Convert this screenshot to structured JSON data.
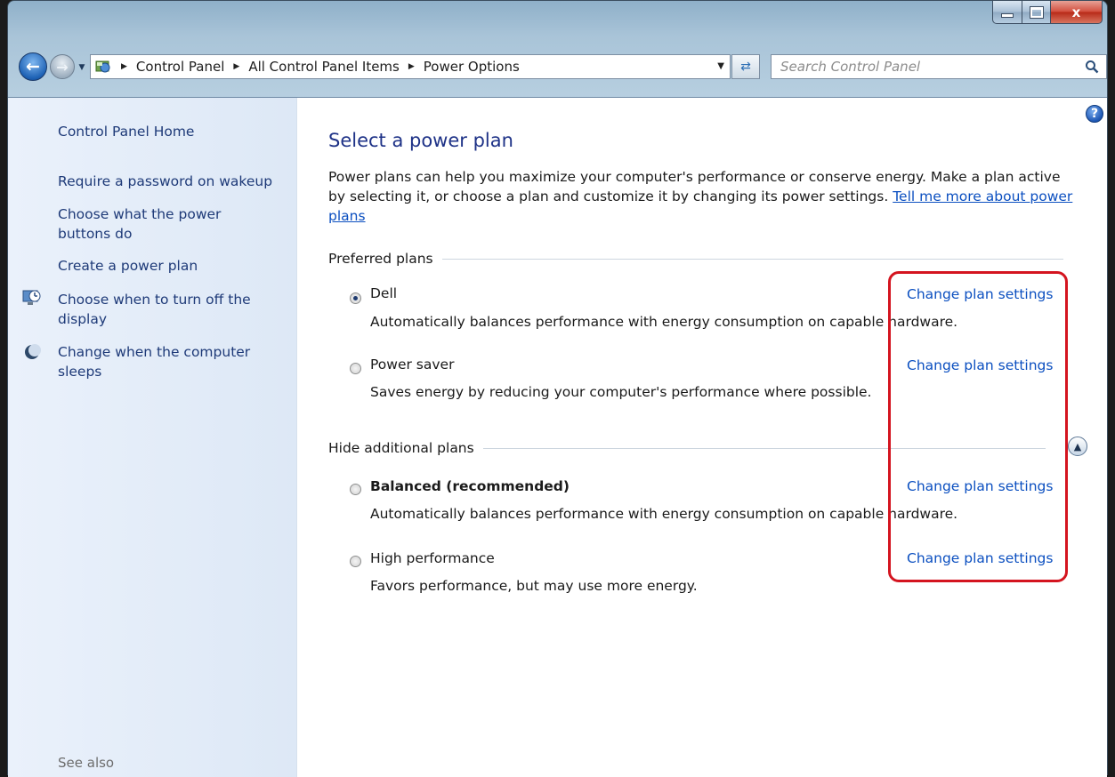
{
  "titlebar": {
    "minimize_icon": "minimize-icon",
    "maximize_icon": "maximize-icon",
    "close_label": "x"
  },
  "nav": {
    "back_icon": "back-arrow-icon",
    "forward_icon": "forward-arrow-icon",
    "breadcrumbs": [
      "Control Panel",
      "All Control Panel Items",
      "Power Options"
    ],
    "search_placeholder": "Search Control Panel",
    "refresh_icon": "refresh-icon"
  },
  "sidebar": {
    "home": "Control Panel Home",
    "links": [
      {
        "label": "Require a password on wakeup"
      },
      {
        "label": "Choose what the power buttons do"
      },
      {
        "label": "Create a power plan"
      },
      {
        "label": "Choose when to turn off the display",
        "icon": "display-clock-icon"
      },
      {
        "label": "Change when the computer sleeps",
        "icon": "moon-icon"
      }
    ],
    "see_also": "See also"
  },
  "main": {
    "title": "Select a power plan",
    "intro": "Power plans can help you maximize your computer's performance or conserve energy. Make a plan active by selecting it, or choose a plan and customize it by changing its power settings. ",
    "intro_link": "Tell me more about power plans",
    "preferred_heading": "Preferred plans",
    "additional_heading": "Hide additional plans",
    "change_link": "Change plan settings",
    "plans": [
      {
        "name": "Dell",
        "desc": "Automatically balances performance with energy consumption on capable hardware.",
        "selected": true
      },
      {
        "name": "Power saver",
        "desc": "Saves energy by reducing your computer's performance where possible.",
        "selected": false
      },
      {
        "name": "Balanced (recommended)",
        "desc": "Automatically balances performance with energy consumption on capable hardware.",
        "selected": false
      },
      {
        "name": "High performance",
        "desc": "Favors performance, but may use more energy.",
        "selected": false
      }
    ],
    "highlight_color": "#d4141f"
  }
}
